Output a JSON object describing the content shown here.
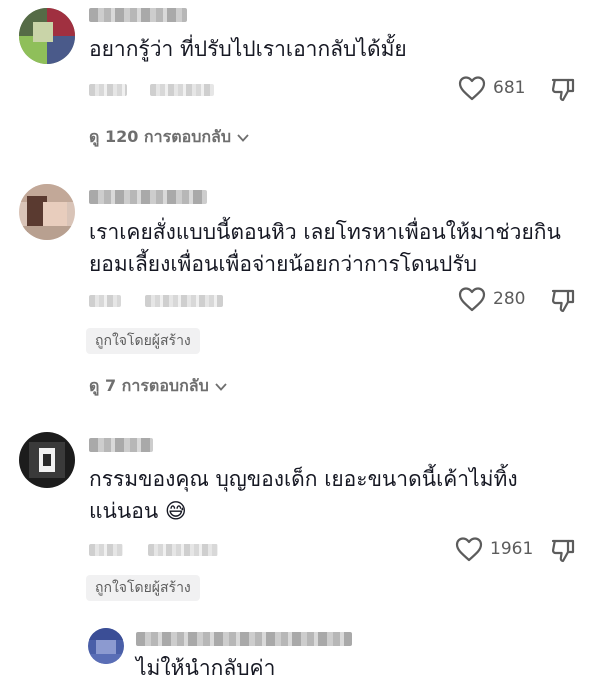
{
  "comments": [
    {
      "text_lines": [
        "อยากรู้ว่า ที่ปรับไปเราเอากลับได้มั้ย"
      ],
      "like_count": "681",
      "replies_label": "ดู 120 การตอบกลับ"
    },
    {
      "text_lines": [
        "เราเคยสั่งแบบนี้ตอนหิว เลยโทรหาเพื่อนให้มาช่วยกิน",
        "ยอมเลี้ยงเพื่อนเพื่อจ่ายน้อยกว่าการโดนปรับ"
      ],
      "like_count": "280",
      "creator_badge": "ถูกใจโดยผู้สร้าง",
      "replies_label": "ดู 7 การตอบกลับ"
    },
    {
      "text_lines": [
        "กรรมของคุณ บุญของเด็ก เยอะขนาดนี้เค้าไม่ทิ้ง",
        "แน่นอน 😅"
      ],
      "like_count": "1961",
      "creator_badge": "ถูกใจโดยผู้สร้าง"
    }
  ],
  "reply": {
    "text": "ไม่ให้นำกลับค่า"
  },
  "icons": [
    "heart-icon",
    "dislike-icon",
    "chevron-down-icon"
  ],
  "colors": {
    "text": "#161823",
    "secondary": "#6f6f6f",
    "badge_bg": "#f1f1f2"
  }
}
